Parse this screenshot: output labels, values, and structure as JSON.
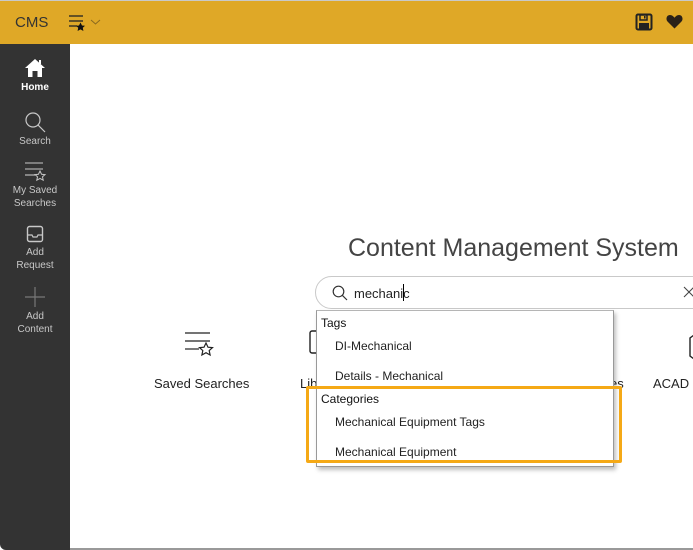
{
  "app": {
    "title": "CMS",
    "saved_searches_menu_icon": "saved-searches-icon",
    "save_icon": "floppy-disk-icon",
    "favorite_icon": "heart-icon"
  },
  "sidebar": {
    "items": [
      {
        "label": "Home",
        "icon": "home-icon",
        "active": true
      },
      {
        "label": "Search",
        "icon": "search-icon"
      },
      {
        "label": "My Saved\nSearches",
        "label_line1": "My Saved",
        "label_line2": "Searches",
        "icon": "saved-searches-icon"
      },
      {
        "label_line1": "Add",
        "label_line2": "Request",
        "icon": "inbox-icon"
      },
      {
        "label_line1": "Add",
        "label_line2": "Content",
        "icon": "plus-icon"
      }
    ]
  },
  "main": {
    "title": "Content Management System",
    "search": {
      "value": "mechanic",
      "clear_icon": "close-icon"
    },
    "tiles": [
      {
        "label": "Saved Searches",
        "icon": "saved-searches-icon"
      },
      {
        "label": "Lib",
        "icon": "library-icon"
      },
      {
        "label": "es",
        "icon": ""
      },
      {
        "label": "ACAD C",
        "icon": "acad-icon"
      }
    ],
    "dropdown": {
      "groups": [
        {
          "header": "Tags",
          "items": [
            "DI-Mechanical",
            "Details - Mechanical"
          ]
        },
        {
          "header": "Categories",
          "items": [
            "Mechanical Equipment Tags",
            "Mechanical Equipment"
          ]
        }
      ]
    },
    "highlight_color": "#F5A916"
  },
  "colors": {
    "titlebar": "#DFA827",
    "sidebar": "#333333"
  }
}
